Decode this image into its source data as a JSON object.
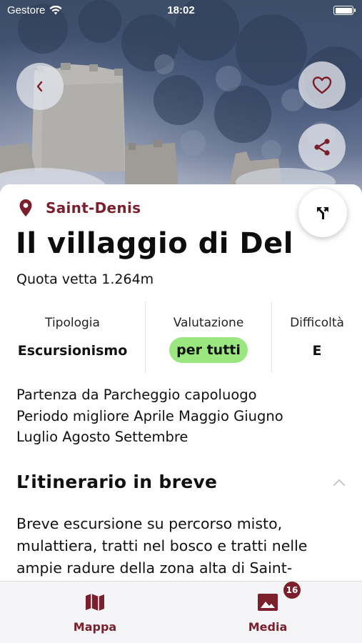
{
  "status_bar": {
    "carrier": "Gestore",
    "time": "18:02"
  },
  "location": {
    "name": "Saint-Denis"
  },
  "title": "Il villaggio di Del",
  "subtitle": "Quota vetta 1.264m",
  "info": [
    {
      "heading": "Tipologia",
      "value": "Escursionismo"
    },
    {
      "heading": "Valutazione",
      "value": "per tutti"
    },
    {
      "heading": "Difficoltà",
      "value": "E"
    }
  ],
  "details": {
    "line1": "Partenza da Parcheggio capoluogo",
    "line2": "Periodo migliore Aprile Maggio Giugno",
    "line3": "Luglio Agosto Settembre"
  },
  "section": {
    "title": "L’itinerario in breve"
  },
  "description": "Breve escursione su percorso misto, mulattiera, tratti nel bosco e tratti nelle ampie radure della zona alta di Saint-",
  "tabs": [
    {
      "label": "Mappa",
      "icon": "map-icon"
    },
    {
      "label": "Media",
      "icon": "image-icon",
      "badge": "16"
    }
  ],
  "colors": {
    "accent": "#7a1f2b",
    "pill": "#9ae67f",
    "tabbar": "#f5f5f7"
  }
}
